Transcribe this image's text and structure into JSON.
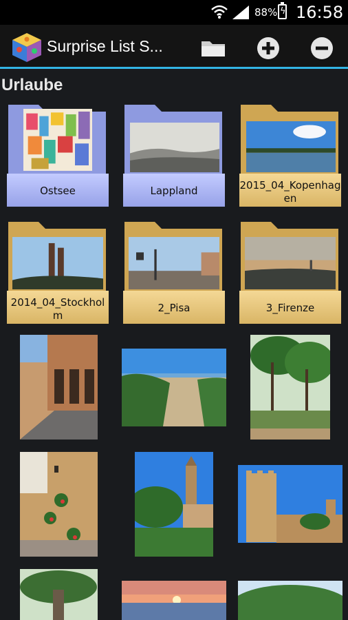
{
  "status_bar": {
    "battery_percent": "88%",
    "time": "16:58"
  },
  "app_bar": {
    "title": "Surprise List S...",
    "icons": [
      "app-logo-icon",
      "folder-icon",
      "add-icon",
      "remove-icon"
    ]
  },
  "section": {
    "title": "Urlaube"
  },
  "folders": [
    {
      "label": "Ostsee",
      "style": "blue"
    },
    {
      "label": "Lappland",
      "style": "blue"
    },
    {
      "label": "2015_04_Kopenhagen",
      "style": "yellow"
    },
    {
      "label": "2014_04_Stockholm",
      "style": "yellow"
    },
    {
      "label": "2_Pisa",
      "style": "yellow"
    },
    {
      "label": "3_Firenze",
      "style": "yellow"
    }
  ],
  "colors": {
    "accent": "#33b5e5",
    "folder_blue": "#aab4f2",
    "folder_yellow": "#e8c779"
  },
  "photos": [
    "arcade-street-photo",
    "beach-dunes-photo",
    "pine-forest-photo",
    "alley-flowers-photo",
    "church-tower-photo",
    "castle-photo",
    "tree-photo",
    "sunset-photo",
    "vineyard-photo"
  ]
}
